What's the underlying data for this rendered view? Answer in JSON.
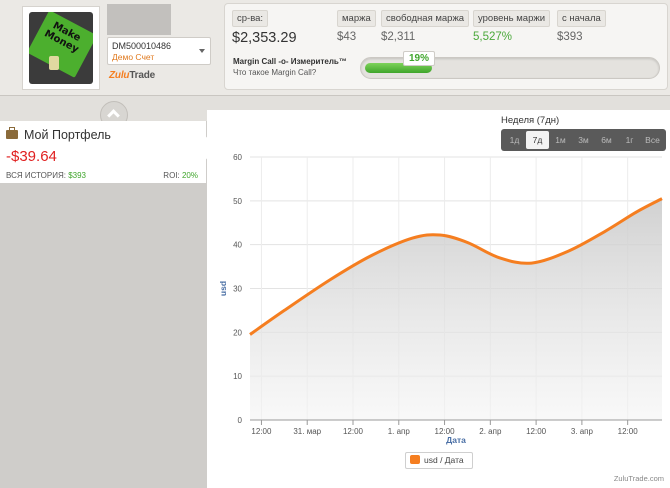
{
  "header": {
    "avatar_text": "Make Money",
    "account": {
      "id": "DM500010486",
      "type": "Демо Счет"
    },
    "logo": {
      "prefix": "Zulu",
      "suffix": "Trade"
    }
  },
  "metrics": [
    {
      "label": "ср-ва:",
      "value": "$2,353.29"
    },
    {
      "label": "маржа",
      "value": "$43"
    },
    {
      "label": "свободная маржа",
      "value": "$2,311"
    },
    {
      "label": "уровень маржи",
      "value": "5,527%"
    },
    {
      "label": "с начала",
      "value": "$393"
    }
  ],
  "margin_call": {
    "title": "Margin Call -o- Измеритель™",
    "subtitle": "Что такое Margin Call?",
    "percent_label": "19%",
    "level": 0.19
  },
  "portfolio": {
    "title": "Мой Портфель",
    "value": "-$39.64",
    "history_label": "ВСЯ ИСТОРИЯ:",
    "history_value": "$393",
    "roi_label": "ROI:",
    "roi_value": "20%"
  },
  "range": {
    "label": "Неделя (7дн)",
    "options": [
      "1д",
      "7д",
      "1м",
      "3м",
      "6м",
      "1г",
      "Все"
    ],
    "active": "7д"
  },
  "chart_data": {
    "type": "area",
    "xlabel": "Дата",
    "ylabel": "usd",
    "ylim": [
      0,
      60
    ],
    "yticks": [
      0,
      10,
      20,
      30,
      40,
      50,
      60
    ],
    "xticks": [
      "12:00",
      "31. мар",
      "12:00",
      "1. апр",
      "12:00",
      "2. апр",
      "12:00",
      "3. апр",
      "12:00"
    ],
    "grid": true,
    "legend_placement": "bottom-center",
    "series": [
      {
        "name": "usd / Дата",
        "color": "#f57e20",
        "points": [
          [
            -0.25,
            19.5
          ],
          [
            0.5,
            25
          ],
          [
            1.5,
            32
          ],
          [
            2.4,
            37.5
          ],
          [
            3.3,
            41.5
          ],
          [
            3.9,
            42.2
          ],
          [
            4.5,
            40.5
          ],
          [
            5.2,
            37
          ],
          [
            5.9,
            35.8
          ],
          [
            6.7,
            38.5
          ],
          [
            7.5,
            43
          ],
          [
            8.2,
            47.5
          ],
          [
            8.75,
            50.5
          ]
        ]
      }
    ]
  },
  "footer": {
    "credit": "ZuluTrade.com"
  }
}
